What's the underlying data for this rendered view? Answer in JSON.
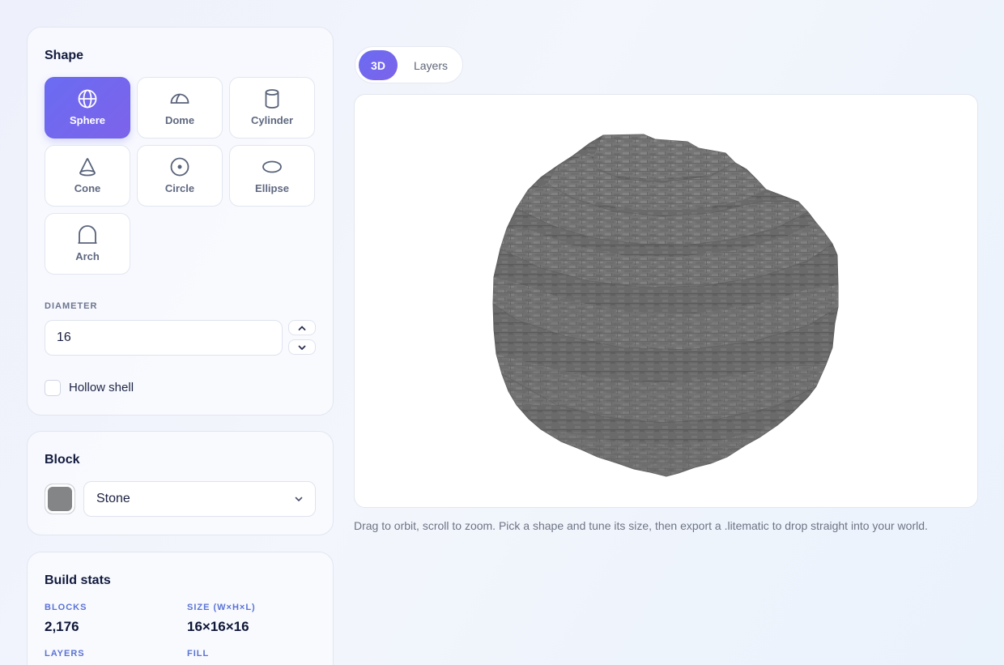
{
  "shape_panel": {
    "title": "Shape",
    "shapes": [
      {
        "label": "Sphere",
        "icon": "sphere-icon",
        "active": true
      },
      {
        "label": "Dome",
        "icon": "dome-icon",
        "active": false
      },
      {
        "label": "Cylinder",
        "icon": "cylinder-icon",
        "active": false
      },
      {
        "label": "Cone",
        "icon": "cone-icon",
        "active": false
      },
      {
        "label": "Circle",
        "icon": "circle-icon",
        "active": false
      },
      {
        "label": "Ellipse",
        "icon": "ellipse-icon",
        "active": false
      },
      {
        "label": "Arch",
        "icon": "arch-icon",
        "active": false
      }
    ],
    "diameter_label": "DIAMETER",
    "diameter_value": "16",
    "stepper_up_icon": "chevron-up-icon",
    "stepper_down_icon": "chevron-down-icon",
    "hollow_label": "Hollow shell",
    "hollow_checked": false
  },
  "block_panel": {
    "title": "Block",
    "selected": "Stone",
    "swatch_color": "#848587",
    "dropdown_icon": "chevron-down-icon"
  },
  "stats_panel": {
    "title": "Build stats",
    "stats": [
      {
        "label": "BLOCKS",
        "value": "2,176"
      },
      {
        "label": "SIZE (W×H×L)",
        "value": "16×16×16"
      },
      {
        "label": "LAYERS"
      },
      {
        "label": "FILL"
      }
    ]
  },
  "view_tabs": [
    {
      "label": "3D",
      "active": true
    },
    {
      "label": "Layers",
      "active": false
    }
  ],
  "viewport": {
    "block": "Stone",
    "block_color": "#7a7a7a"
  },
  "hint": "Drag to orbit, scroll to zoom. Pick a shape and tune its size, then export a .litematic to drop straight into your world.",
  "colors": {
    "accent": "#6a6cf2",
    "accent_secondary": "#7d63ea",
    "stat_label": "#5b73d6"
  }
}
